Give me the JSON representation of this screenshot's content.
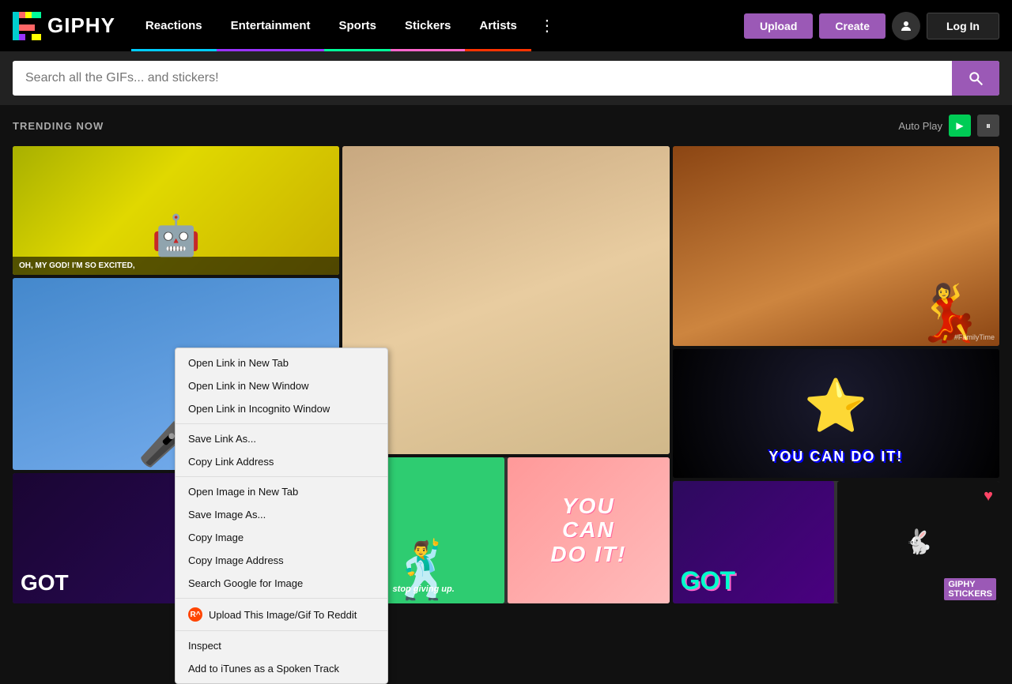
{
  "header": {
    "logo_text": "GIPHY",
    "nav_items": [
      {
        "label": "Reactions",
        "id": "reactions",
        "color": "#00ccff"
      },
      {
        "label": "Entertainment",
        "id": "entertainment",
        "color": "#9933ff"
      },
      {
        "label": "Sports",
        "id": "sports",
        "color": "#00ff99"
      },
      {
        "label": "Stickers",
        "id": "stickers",
        "color": "#ff66cc"
      },
      {
        "label": "Artists",
        "id": "artists",
        "color": "#ff3300"
      }
    ],
    "upload_label": "Upload",
    "create_label": "Create",
    "login_label": "Log In"
  },
  "search": {
    "placeholder": "Search all the GIFs... and stickers!"
  },
  "trending": {
    "label": "TRENDING NOW",
    "autoplay_label": "Auto Play"
  },
  "context_menu": {
    "items": [
      {
        "label": "Open Link in New Tab",
        "group": 1
      },
      {
        "label": "Open Link in New Window",
        "group": 1
      },
      {
        "label": "Open Link in Incognito Window",
        "group": 1
      },
      {
        "label": "Save Link As...",
        "group": 2
      },
      {
        "label": "Copy Link Address",
        "group": 2
      },
      {
        "label": "Open Image in New Tab",
        "group": 3
      },
      {
        "label": "Save Image As...",
        "group": 3
      },
      {
        "label": "Copy Image",
        "group": 3
      },
      {
        "label": "Copy Image Address",
        "group": 3
      },
      {
        "label": "Search Google for Image",
        "group": 3
      },
      {
        "label": "Upload This Image/Gif To Reddit",
        "group": 4,
        "has_icon": true
      },
      {
        "label": "Inspect",
        "group": 5
      },
      {
        "label": "Add to iTunes as a Spoken Track",
        "group": 5
      }
    ]
  },
  "gifs": {
    "excited_caption": "OH, MY GOD! I'M SO EXCITED,",
    "youcanfit_text": "YOU CAN DO IT!",
    "got_text": "GOT",
    "stop_giving_up": "stop giving up.",
    "familytime": "#FamilyTime",
    "youcandoit_pink_text": "YOU CAN\nDO IT!"
  }
}
